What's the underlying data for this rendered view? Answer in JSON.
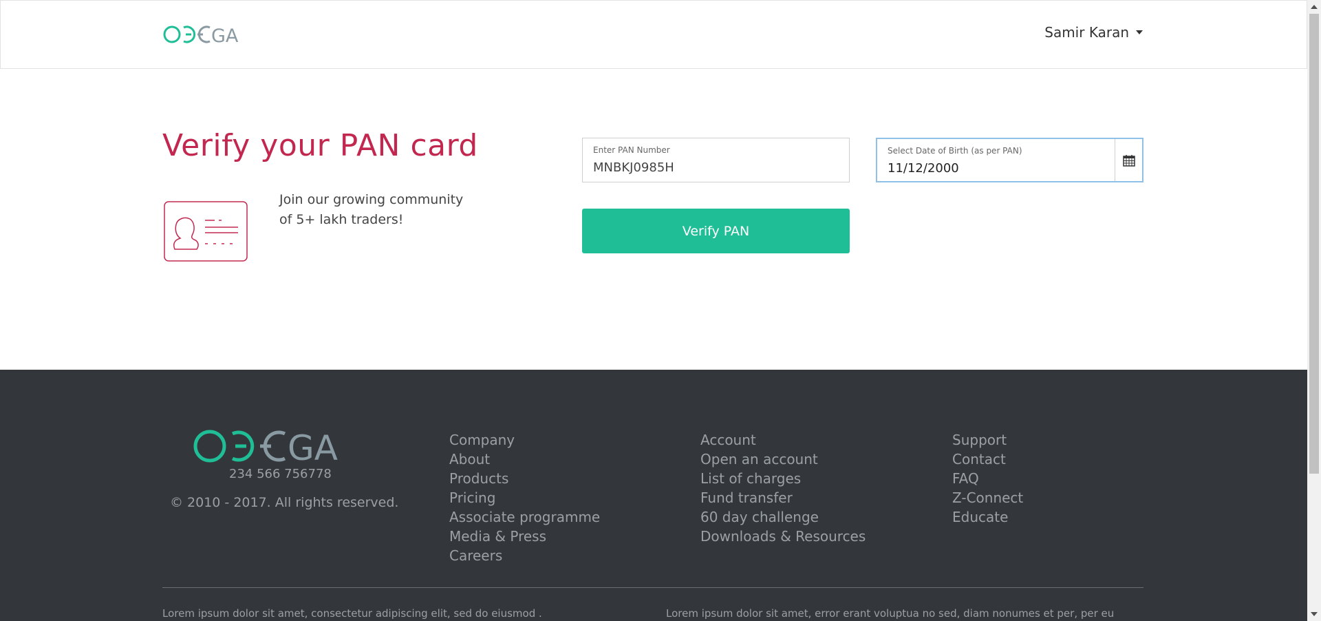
{
  "header": {
    "logo_text": "OMEGA",
    "user_name": "Samir Karan"
  },
  "main": {
    "title": "Verify your PAN card",
    "community_line1": "Join our growing community",
    "community_line2": "of 5+ lakh traders!",
    "pan_field": {
      "label": "Enter PAN Number",
      "value": "MNBKJ0985H"
    },
    "dob_field": {
      "label": "Select Date of Birth (as per PAN)",
      "value": "11/12/2000"
    },
    "verify_button": "Verify PAN"
  },
  "footer": {
    "logo_text": "OMEGA",
    "phone": "234 566 756778",
    "copyright": "© 2010 - 2017. All rights reserved.",
    "col1": [
      "Company",
      "About",
      "Products",
      "Pricing",
      "Associate programme",
      "Media & Press",
      "Careers"
    ],
    "col2": [
      "Account",
      "Open an account",
      "List of charges",
      "Fund transfer",
      "60 day challenge",
      "Downloads & Resources"
    ],
    "col3": [
      "Support",
      "Contact",
      "FAQ",
      "Z-Connect",
      "Educate"
    ],
    "lorem_left": "Lorem ipsum dolor sit amet, consectetur adipiscing elit, sed do eiusmod .",
    "lorem_right": "Lorem ipsum dolor sit amet, error erant voluptua no sed, diam nonumes et per, per eu"
  },
  "colors": {
    "accent_green": "#20be96",
    "title_red": "#c2284f",
    "footer_bg": "#33373b",
    "logo_gray": "#8a9aa3"
  }
}
